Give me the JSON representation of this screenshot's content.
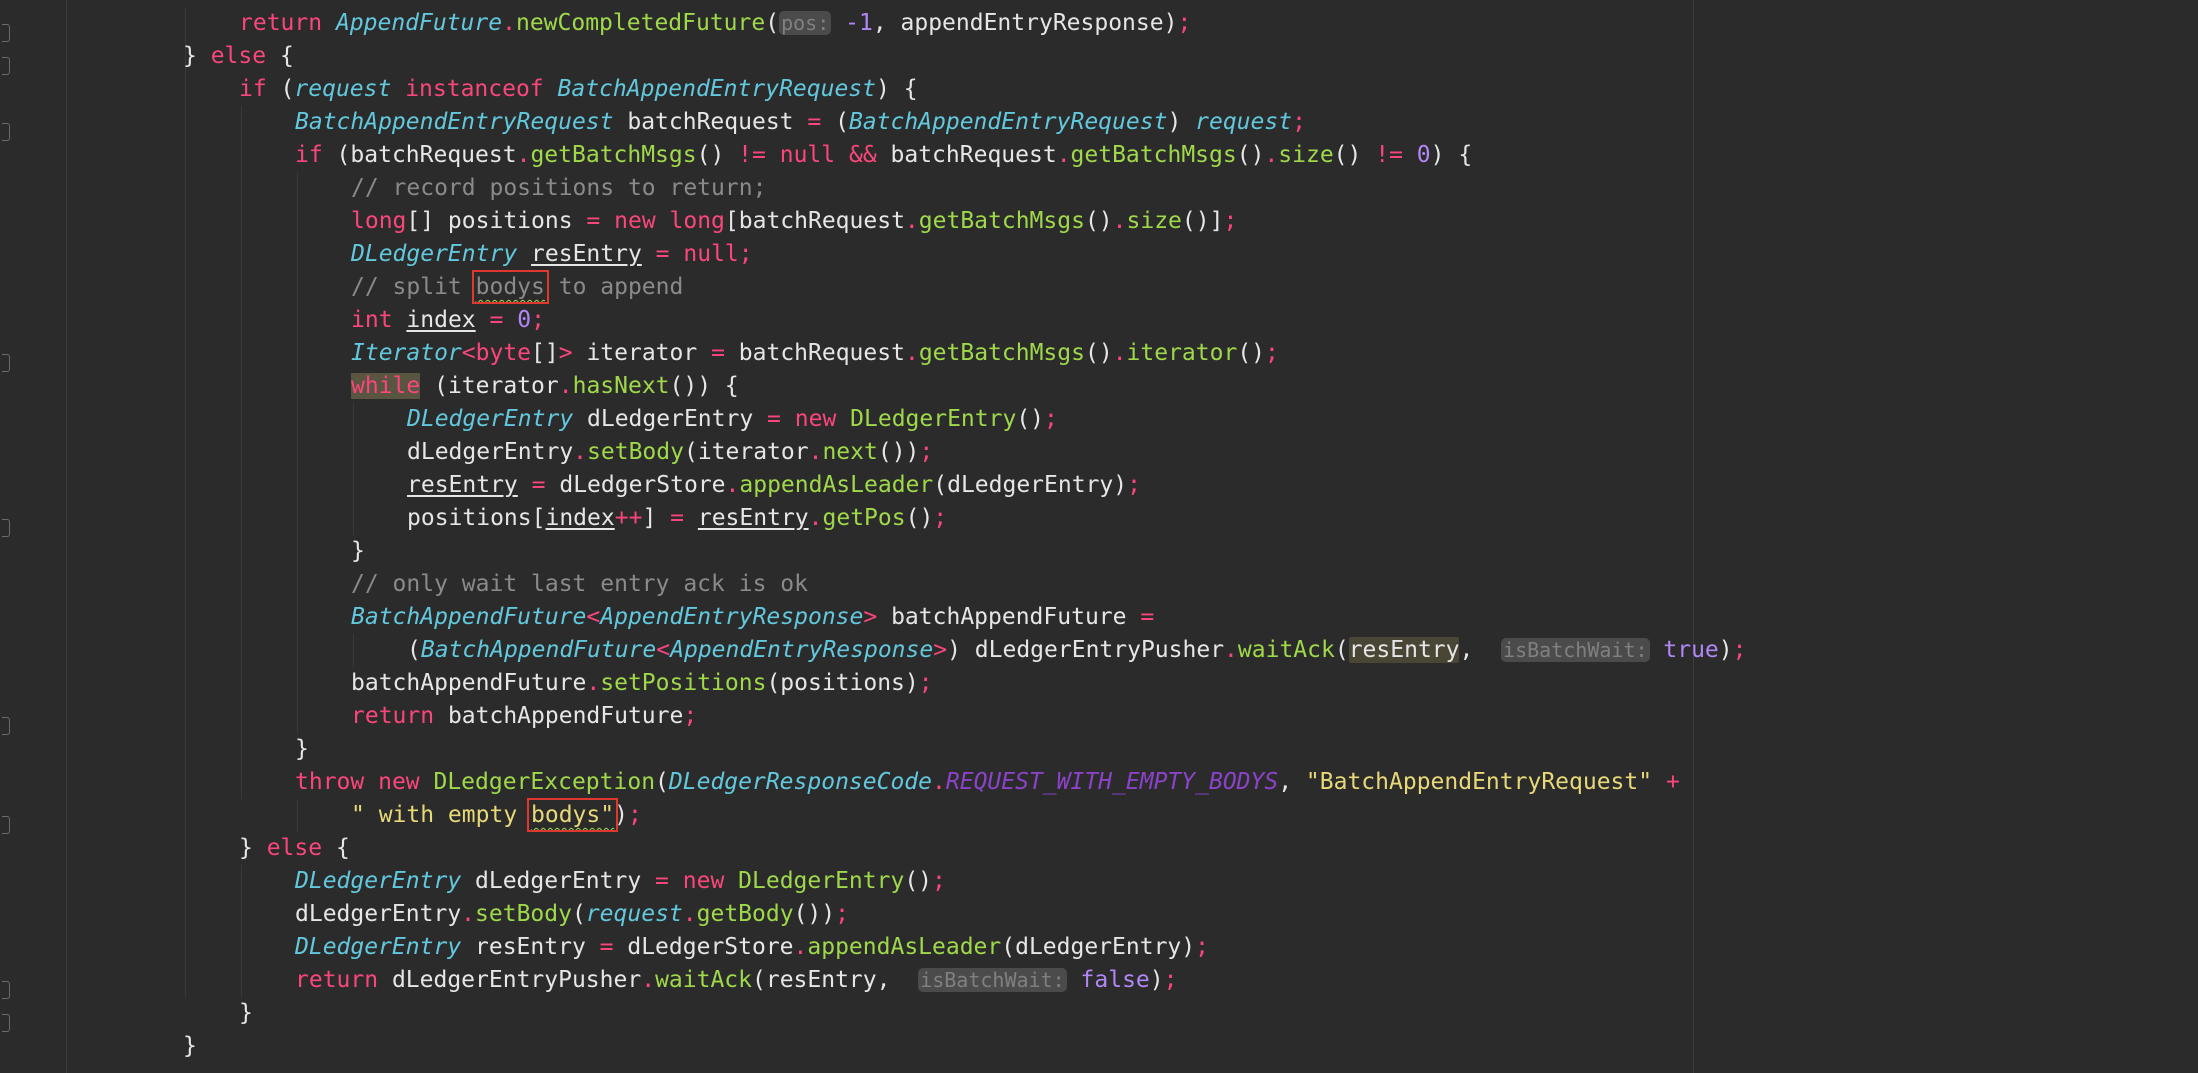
{
  "code_lines": [
    {
      "indent": 1,
      "tokens": [
        [
          "kw",
          "return "
        ],
        [
          "cls",
          "AppendFuture"
        ],
        [
          "op",
          "."
        ],
        [
          "fn",
          "newCompletedFuture"
        ],
        [
          "p",
          "("
        ],
        [
          "hint",
          "pos:"
        ],
        [
          "p",
          " "
        ],
        [
          "num",
          "-1"
        ],
        [
          "p",
          ", appendEntryResponse)"
        ],
        [
          "op",
          ";"
        ]
      ]
    },
    {
      "indent": 0,
      "tokens": [
        [
          "p",
          "} "
        ],
        [
          "kw",
          "else"
        ],
        [
          "p",
          " {"
        ]
      ]
    },
    {
      "indent": 1,
      "tokens": [
        [
          "kw",
          "if"
        ],
        [
          "p",
          " ("
        ],
        [
          "param",
          "request "
        ],
        [
          "kw",
          "instanceof "
        ],
        [
          "cls",
          "BatchAppendEntryRequest"
        ],
        [
          "p",
          ") {"
        ]
      ]
    },
    {
      "indent": 2,
      "tokens": [
        [
          "cls",
          "BatchAppendEntryRequest"
        ],
        [
          "p",
          " batchRequest "
        ],
        [
          "op",
          "="
        ],
        [
          "p",
          " ("
        ],
        [
          "cls",
          "BatchAppendEntryRequest"
        ],
        [
          "p",
          ") "
        ],
        [
          "param",
          "request"
        ],
        [
          "op",
          ";"
        ]
      ]
    },
    {
      "indent": 2,
      "tokens": [
        [
          "kw",
          "if"
        ],
        [
          "p",
          " (batchRequest"
        ],
        [
          "op",
          "."
        ],
        [
          "fn",
          "getBatchMsgs"
        ],
        [
          "p",
          "() "
        ],
        [
          "op",
          "!="
        ],
        [
          "p",
          " "
        ],
        [
          "kw",
          "null"
        ],
        [
          "p",
          " "
        ],
        [
          "op",
          "&&"
        ],
        [
          "p",
          " batchRequest"
        ],
        [
          "op",
          "."
        ],
        [
          "fn",
          "getBatchMsgs"
        ],
        [
          "p",
          "()"
        ],
        [
          "op",
          "."
        ],
        [
          "fn",
          "size"
        ],
        [
          "p",
          "() "
        ],
        [
          "op",
          "!="
        ],
        [
          "p",
          " "
        ],
        [
          "num",
          "0"
        ],
        [
          "p",
          ") {"
        ]
      ]
    },
    {
      "indent": 3,
      "tokens": [
        [
          "cmt",
          "// record positions to return;"
        ]
      ]
    },
    {
      "indent": 3,
      "tokens": [
        [
          "kw",
          "long"
        ],
        [
          "p",
          "[] positions "
        ],
        [
          "op",
          "="
        ],
        [
          "p",
          " "
        ],
        [
          "kw",
          "new "
        ],
        [
          "kw",
          "long"
        ],
        [
          "p",
          "[batchRequest"
        ],
        [
          "op",
          "."
        ],
        [
          "fn",
          "getBatchMsgs"
        ],
        [
          "p",
          "()"
        ],
        [
          "op",
          "."
        ],
        [
          "fn",
          "size"
        ],
        [
          "p",
          "()]"
        ],
        [
          "op",
          ";"
        ]
      ]
    },
    {
      "indent": 3,
      "tokens": [
        [
          "cls",
          "DLedgerEntry"
        ],
        [
          "p",
          " "
        ],
        [
          "ul",
          "resEntry"
        ],
        [
          "p",
          " "
        ],
        [
          "op",
          "="
        ],
        [
          "p",
          " "
        ],
        [
          "kw",
          "null"
        ],
        [
          "op",
          ";"
        ]
      ]
    },
    {
      "indent": 3,
      "tokens": [
        [
          "cmt",
          "// split "
        ],
        [
          "box",
          "bodys"
        ],
        [
          "cmt",
          " to append"
        ]
      ]
    },
    {
      "indent": 3,
      "tokens": [
        [
          "kw",
          "int"
        ],
        [
          "p",
          " "
        ],
        [
          "ul",
          "index"
        ],
        [
          "p",
          " "
        ],
        [
          "op",
          "="
        ],
        [
          "p",
          " "
        ],
        [
          "num",
          "0"
        ],
        [
          "op",
          ";"
        ]
      ]
    },
    {
      "indent": 3,
      "tokens": [
        [
          "cls",
          "Iterator"
        ],
        [
          "op",
          "<"
        ],
        [
          "kw",
          "byte"
        ],
        [
          "p",
          "[]"
        ],
        [
          "op",
          ">"
        ],
        [
          "p",
          " iterator "
        ],
        [
          "op",
          "="
        ],
        [
          "p",
          " batchRequest"
        ],
        [
          "op",
          "."
        ],
        [
          "fn",
          "getBatchMsgs"
        ],
        [
          "p",
          "()"
        ],
        [
          "op",
          "."
        ],
        [
          "fn",
          "iterator"
        ],
        [
          "p",
          "()"
        ],
        [
          "op",
          ";"
        ]
      ]
    },
    {
      "indent": 3,
      "tokens": [
        [
          "while",
          "while"
        ],
        [
          "p",
          " (iterator"
        ],
        [
          "op",
          "."
        ],
        [
          "fn",
          "hasNext"
        ],
        [
          "p",
          "()) {"
        ]
      ]
    },
    {
      "indent": 4,
      "tokens": [
        [
          "cls",
          "DLedgerEntry"
        ],
        [
          "p",
          " dLedgerEntry "
        ],
        [
          "op",
          "="
        ],
        [
          "p",
          " "
        ],
        [
          "kw",
          "new "
        ],
        [
          "fn",
          "DLedgerEntry"
        ],
        [
          "p",
          "()"
        ],
        [
          "op",
          ";"
        ]
      ]
    },
    {
      "indent": 4,
      "tokens": [
        [
          "p",
          "dLedgerEntry"
        ],
        [
          "op",
          "."
        ],
        [
          "fn",
          "setBody"
        ],
        [
          "p",
          "(iterator"
        ],
        [
          "op",
          "."
        ],
        [
          "fn",
          "next"
        ],
        [
          "p",
          "())"
        ],
        [
          "op",
          ";"
        ]
      ]
    },
    {
      "indent": 4,
      "tokens": [
        [
          "ul",
          "resEntry"
        ],
        [
          "p",
          " "
        ],
        [
          "op",
          "="
        ],
        [
          "p",
          " dLedgerStore"
        ],
        [
          "op",
          "."
        ],
        [
          "fn",
          "appendAsLeader"
        ],
        [
          "p",
          "(dLedgerEntry)"
        ],
        [
          "op",
          ";"
        ]
      ]
    },
    {
      "indent": 4,
      "tokens": [
        [
          "p",
          "positions["
        ],
        [
          "ul",
          "index"
        ],
        [
          "op",
          "++"
        ],
        [
          "p",
          "] "
        ],
        [
          "op",
          "="
        ],
        [
          "p",
          " "
        ],
        [
          "ul",
          "resEntry"
        ],
        [
          "op",
          "."
        ],
        [
          "fn",
          "getPos"
        ],
        [
          "p",
          "()"
        ],
        [
          "op",
          ";"
        ]
      ]
    },
    {
      "indent": 3,
      "tokens": [
        [
          "p",
          "}"
        ]
      ]
    },
    {
      "indent": 3,
      "tokens": [
        [
          "cmt",
          "// only wait last entry ack is ok"
        ]
      ]
    },
    {
      "indent": 3,
      "tokens": [
        [
          "cls",
          "BatchAppendFuture"
        ],
        [
          "op",
          "<"
        ],
        [
          "cls",
          "AppendEntryResponse"
        ],
        [
          "op",
          ">"
        ],
        [
          "p",
          " batchAppendFuture "
        ],
        [
          "op",
          "="
        ]
      ]
    },
    {
      "indent": 4,
      "tokens": [
        [
          "p",
          "("
        ],
        [
          "cls",
          "BatchAppendFuture"
        ],
        [
          "op",
          "<"
        ],
        [
          "cls",
          "AppendEntryResponse"
        ],
        [
          "op",
          ">"
        ],
        [
          "p",
          ") dLedgerEntryPusher"
        ],
        [
          "op",
          "."
        ],
        [
          "fn",
          "waitAck"
        ],
        [
          "p",
          "("
        ],
        [
          "hlword",
          "resEntry"
        ],
        [
          "p",
          ",  "
        ],
        [
          "hint",
          "isBatchWait:"
        ],
        [
          "p",
          " "
        ],
        [
          "num",
          "true"
        ],
        [
          "p",
          ")"
        ],
        [
          "op",
          ";"
        ]
      ]
    },
    {
      "indent": 3,
      "tokens": [
        [
          "p",
          "batchAppendFuture"
        ],
        [
          "op",
          "."
        ],
        [
          "fn",
          "setPositions"
        ],
        [
          "p",
          "(positions)"
        ],
        [
          "op",
          ";"
        ]
      ]
    },
    {
      "indent": 3,
      "tokens": [
        [
          "kw",
          "return"
        ],
        [
          "p",
          " batchAppendFuture"
        ],
        [
          "op",
          ";"
        ]
      ]
    },
    {
      "indent": 2,
      "tokens": [
        [
          "p",
          "}"
        ]
      ]
    },
    {
      "indent": 2,
      "tokens": [
        [
          "kw",
          "throw "
        ],
        [
          "kw",
          "new "
        ],
        [
          "fn",
          "DLedgerException"
        ],
        [
          "p",
          "("
        ],
        [
          "cls",
          "DLedgerResponseCode"
        ],
        [
          "op",
          "."
        ],
        [
          "const",
          "REQUEST_WITH_EMPTY_BODYS"
        ],
        [
          "p",
          ", "
        ],
        [
          "str",
          "\"BatchAppendEntryRequest\""
        ],
        [
          "p",
          " "
        ],
        [
          "op",
          "+"
        ]
      ]
    },
    {
      "indent": 3,
      "tokens": [
        [
          "str",
          "\" with empty "
        ],
        [
          "boxstr",
          "bodys\""
        ],
        [
          "p",
          ")"
        ],
        [
          "op",
          ";"
        ]
      ]
    },
    {
      "indent": 1,
      "tokens": [
        [
          "p",
          "} "
        ],
        [
          "kw",
          "else"
        ],
        [
          "p",
          " {"
        ]
      ]
    },
    {
      "indent": 2,
      "tokens": [
        [
          "cls",
          "DLedgerEntry"
        ],
        [
          "p",
          " dLedgerEntry "
        ],
        [
          "op",
          "="
        ],
        [
          "p",
          " "
        ],
        [
          "kw",
          "new "
        ],
        [
          "fn",
          "DLedgerEntry"
        ],
        [
          "p",
          "()"
        ],
        [
          "op",
          ";"
        ]
      ]
    },
    {
      "indent": 2,
      "tokens": [
        [
          "p",
          "dLedgerEntry"
        ],
        [
          "op",
          "."
        ],
        [
          "fn",
          "setBody"
        ],
        [
          "p",
          "("
        ],
        [
          "param",
          "request"
        ],
        [
          "op",
          "."
        ],
        [
          "fn",
          "getBody"
        ],
        [
          "p",
          "())"
        ],
        [
          "op",
          ";"
        ]
      ]
    },
    {
      "indent": 2,
      "tokens": [
        [
          "cls",
          "DLedgerEntry"
        ],
        [
          "p",
          " resEntry "
        ],
        [
          "op",
          "="
        ],
        [
          "p",
          " dLedgerStore"
        ],
        [
          "op",
          "."
        ],
        [
          "fn",
          "appendAsLeader"
        ],
        [
          "p",
          "(dLedgerEntry)"
        ],
        [
          "op",
          ";"
        ]
      ]
    },
    {
      "indent": 2,
      "tokens": [
        [
          "kw",
          "return"
        ],
        [
          "p",
          " dLedgerEntryPusher"
        ],
        [
          "op",
          "."
        ],
        [
          "fn",
          "waitAck"
        ],
        [
          "p",
          "(resEntry,  "
        ],
        [
          "hint",
          "isBatchWait:"
        ],
        [
          "p",
          " "
        ],
        [
          "num",
          "false"
        ],
        [
          "p",
          ")"
        ],
        [
          "op",
          ";"
        ]
      ]
    },
    {
      "indent": 1,
      "tokens": [
        [
          "p",
          "}"
        ]
      ]
    },
    {
      "indent": 0,
      "tokens": [
        [
          "p",
          "}"
        ]
      ]
    }
  ]
}
